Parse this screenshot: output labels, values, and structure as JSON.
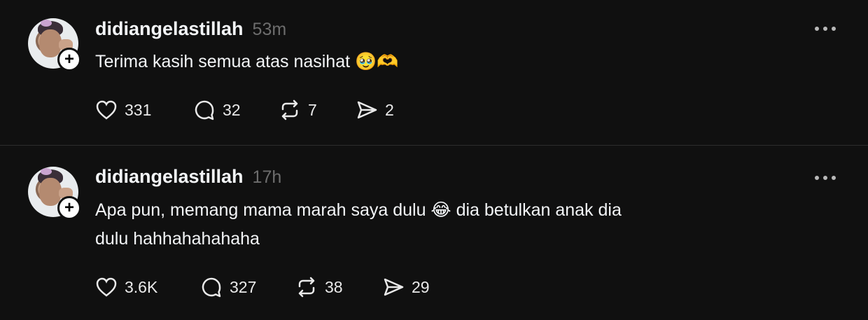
{
  "posts": [
    {
      "username": "didiangelastillah",
      "time": "53m",
      "text_lines": [
        "Terima kasih semua atas nasihat 🥹🫶"
      ],
      "likes": "331",
      "comments": "32",
      "reposts": "7",
      "shares": "2"
    },
    {
      "username": "didiangelastillah",
      "time": "17h",
      "text_lines": [
        "Apa pun, memang mama marah saya dulu 😂 dia betulkan anak dia",
        "dulu hahhahahahaha"
      ],
      "likes": "3.6K",
      "comments": "327",
      "reposts": "38",
      "shares": "29"
    }
  ],
  "ui": {
    "follow_symbol": "+",
    "icons": {
      "like": "heart-icon",
      "comment": "comment-icon",
      "repost": "repost-icon",
      "share": "send-icon",
      "more": "more-dots-icon"
    }
  }
}
